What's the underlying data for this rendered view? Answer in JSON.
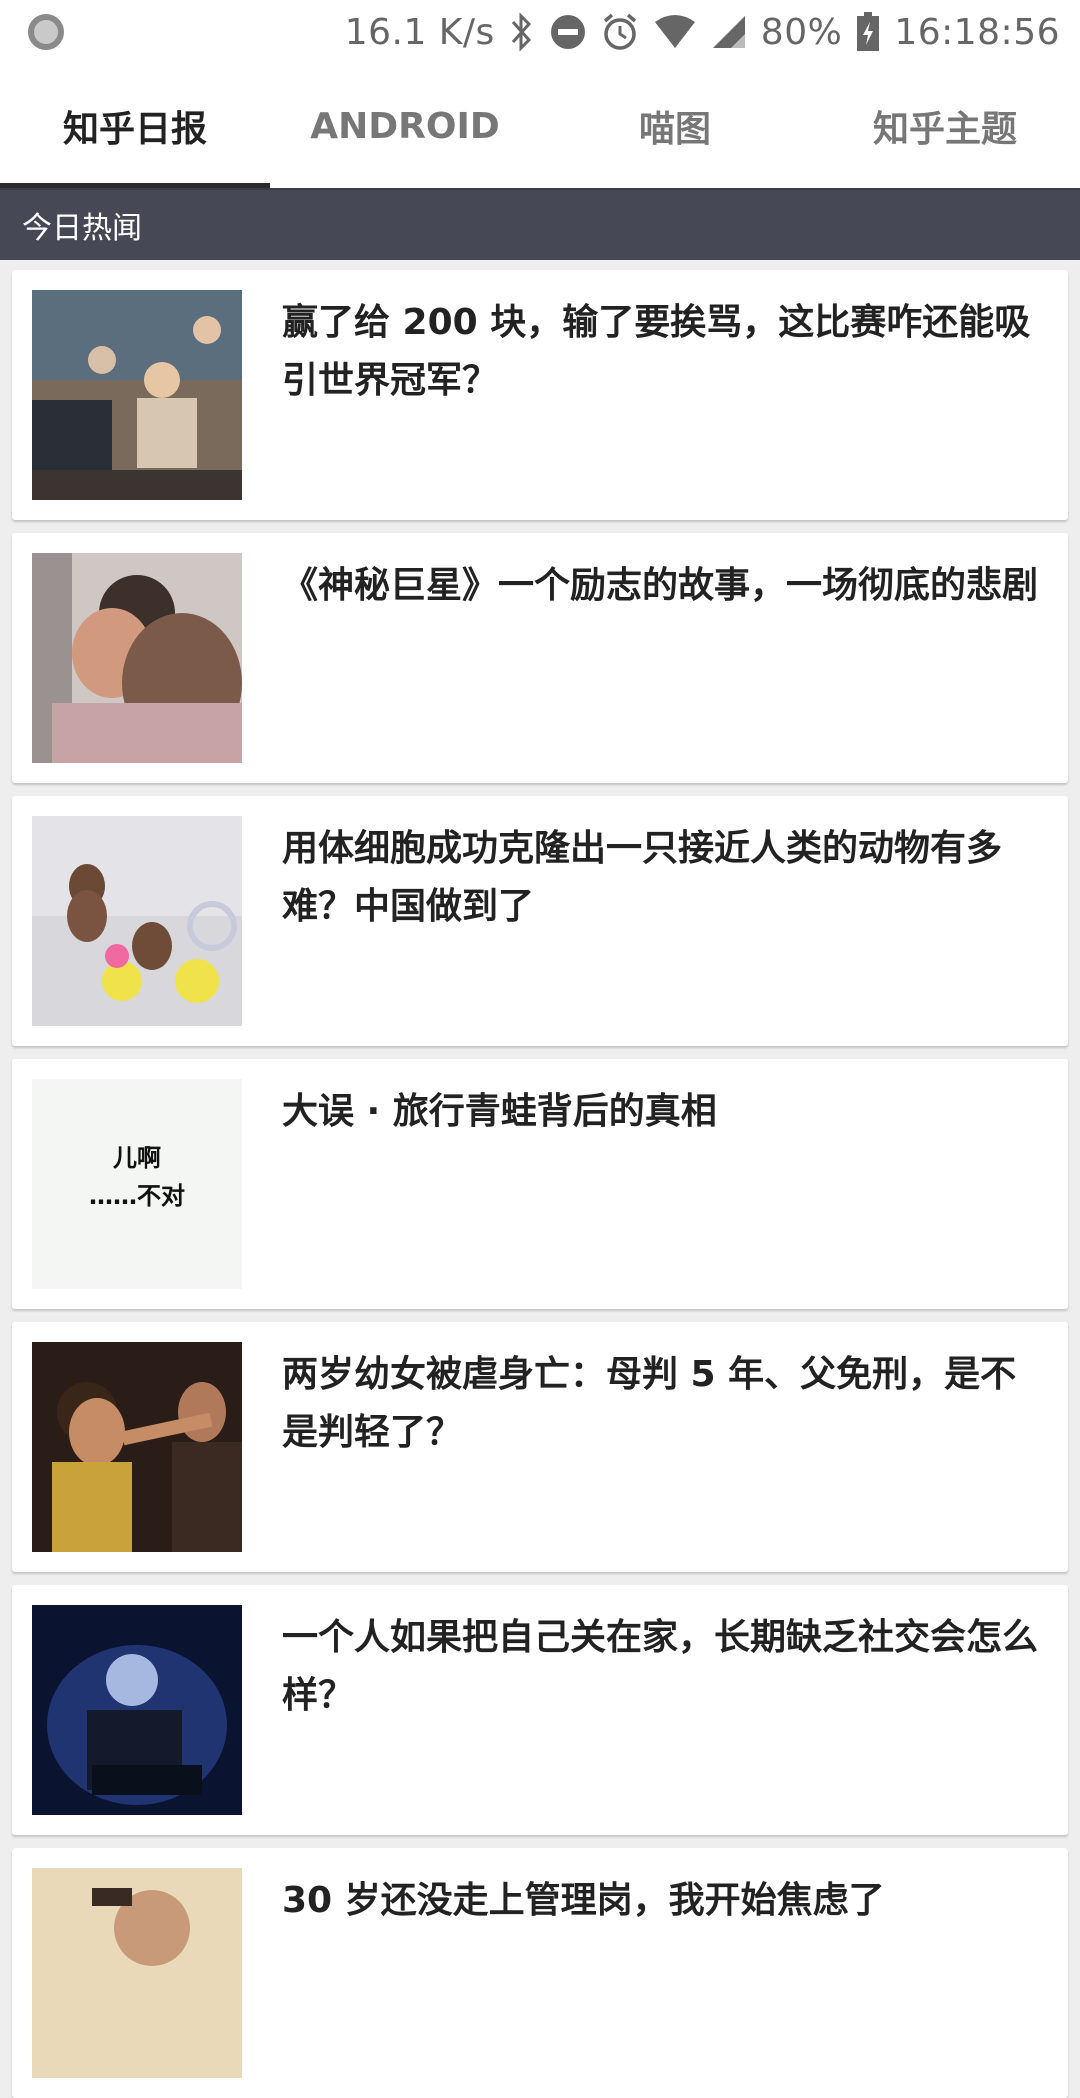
{
  "status_bar": {
    "speed": "16.1 K/s",
    "battery": "80%",
    "time": "16:18:56",
    "icons": [
      "notification-icon",
      "bluetooth-icon",
      "do-not-disturb-icon",
      "alarm-icon",
      "wifi-icon",
      "signal-icon",
      "battery-icon"
    ]
  },
  "tabs": [
    {
      "label": "知乎日报",
      "active": true
    },
    {
      "label": "ANDROID",
      "active": false
    },
    {
      "label": "喵图",
      "active": false
    },
    {
      "label": "知乎主题",
      "active": false
    }
  ],
  "section_header": "今日热闻",
  "news": [
    {
      "title": "赢了给 200 块，输了要挨骂，这比赛咋还能吸引世界冠军？",
      "image": "esports-players-photo"
    },
    {
      "title": "《神秘巨星》一个励志的故事，一场彻底的悲剧",
      "image": "hug-movie-still"
    },
    {
      "title": "用体细胞成功克隆出一只接近人类的动物有多难？中国做到了",
      "image": "cloned-monkeys-photo"
    },
    {
      "title": "大误 · 旅行青蛙背后的真相",
      "image": "text-meme",
      "thumb_text_1": "儿啊",
      "thumb_text_2": "……不对"
    },
    {
      "title": "两岁幼女被虐身亡：母判 5 年、父免刑，是不是判轻了？",
      "image": "movie-still-slap"
    },
    {
      "title": "一个人如果把自己关在家，长期缺乏社交会怎么样？",
      "image": "man-at-laptop-dark"
    },
    {
      "title": "30 岁还没走上管理岗，我开始焦虑了",
      "image": "man-anxious-photo"
    }
  ]
}
